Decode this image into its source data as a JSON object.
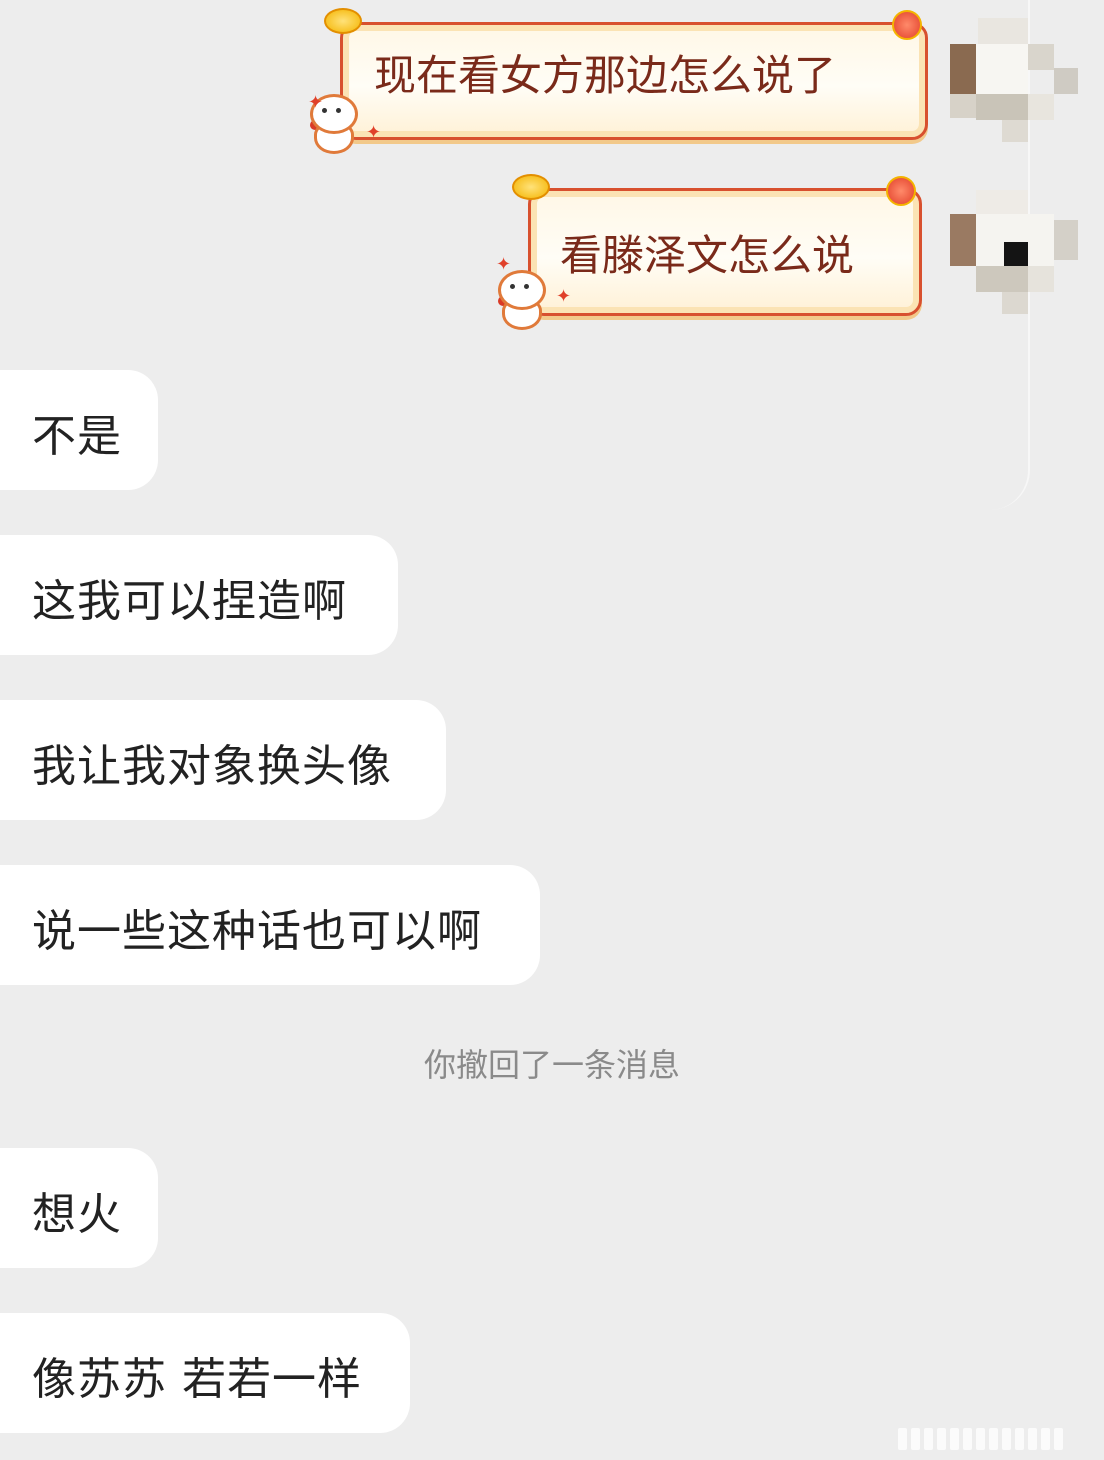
{
  "messages_sent": [
    {
      "text": "现在看女方那边怎么说了"
    },
    {
      "text": "看滕泽文怎么说"
    }
  ],
  "messages_received": [
    {
      "text": "不是"
    },
    {
      "text": "这我可以捏造啊"
    },
    {
      "text": "我让我对象换头像"
    },
    {
      "text": "说一些这种话也可以啊"
    },
    {
      "text": "想火"
    },
    {
      "text": "像苏苏 若若一样"
    }
  ],
  "system_notice": "你撤回了一条消息",
  "colors": {
    "background": "#ededed",
    "received_bubble": "#ffffff",
    "sent_bubble_border": "#d8502e",
    "sent_text": "#7a2a1a",
    "notice_text": "#8a8a8a"
  },
  "icons": {
    "sent_bubble_decoration": "festive-cat-mascot-icon",
    "avatar": "pixelated-avatar"
  }
}
